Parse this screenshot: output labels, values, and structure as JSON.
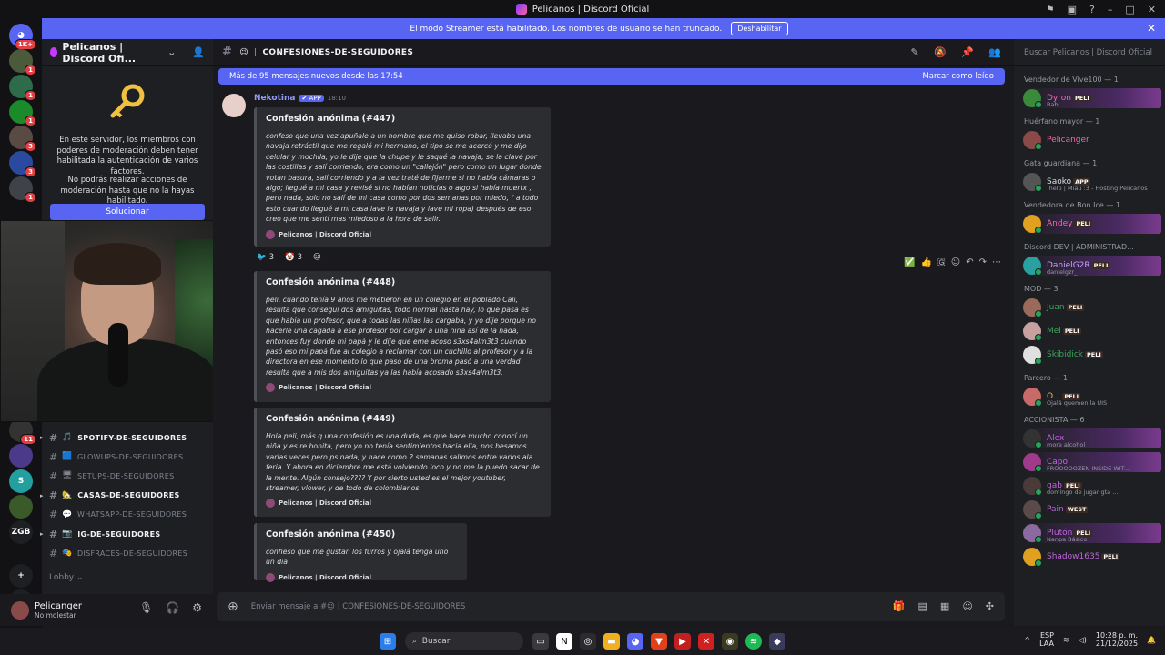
{
  "window": {
    "title": "Pelicanos | Discord Oficial"
  },
  "streamer_banner": {
    "text": "El modo Streamer está habilitado. Los nombres de usuario se han truncado.",
    "button": "Deshabilitar"
  },
  "guilds": {
    "home_badge": "1K+",
    "items": [
      {
        "badge": "1",
        "color": "#4a5a3a"
      },
      {
        "badge": "1",
        "color": "#2e6b4a"
      },
      {
        "badge": "1",
        "color": "#1a8a2a"
      },
      {
        "badge": "3",
        "color": "#5a4a44"
      },
      {
        "badge": "3",
        "color": "#2a4aa0"
      },
      {
        "badge": "1",
        "color": "#404249"
      },
      {
        "badge": "11",
        "color": "#333"
      },
      {
        "badge": "",
        "color": "#4b3a8a"
      },
      {
        "badge": "",
        "color": "#22a0a0",
        "label": "S"
      },
      {
        "badge": "",
        "color": "#3a5a2a"
      },
      {
        "badge": "",
        "color": "#1e1f22",
        "label": "ZGB"
      }
    ]
  },
  "sidebar": {
    "server_name": "Pelicanos | Discord Ofi...",
    "mod_text_1": "En este servidor, los miembros con poderes de moderación deben tener habilitada la autenticación de varios factores.",
    "mod_text_2": "No podrás realizar acciones de moderación hasta que no la hayas habilitado.",
    "fix_button": "Solucionar",
    "channels": [
      {
        "emoji": "🎵",
        "name": "SPOTIFY-DE-SEGUIDORES",
        "bold": true,
        "arrow": true
      },
      {
        "emoji": "🟦",
        "name": "GLOWUPS-DE-SEGUIDORES",
        "bold": false,
        "arrow": false
      },
      {
        "emoji": "🖥",
        "name": "SETUPS-DE-SEGUIDORES",
        "bold": false,
        "arrow": false
      },
      {
        "emoji": "🏡",
        "name": "CASAS-DE-SEGUIDORES",
        "bold": true,
        "arrow": true
      },
      {
        "emoji": "💬",
        "name": "WHATSAPP-DE-SEGUIDORES",
        "bold": false,
        "arrow": false
      },
      {
        "emoji": "📷",
        "name": "IG-DE-SEGUIDORES",
        "bold": true,
        "arrow": true
      },
      {
        "emoji": "🎭",
        "name": "DISFRACES-DE-SEGUIDORES",
        "bold": false,
        "arrow": false
      }
    ],
    "lobby": "Lobby"
  },
  "user": {
    "name": "Pelicanger",
    "status": "No molestar"
  },
  "channel": {
    "name": "CONFESIONES-DE-SEGUIDORES",
    "emoji": "😉"
  },
  "new_messages": {
    "text": "Más de 95 mensajes nuevos desde las 17:54",
    "action": "Marcar como leído"
  },
  "message": {
    "author": "Nekotina",
    "app_tag": "✔ APP",
    "time": "18:10"
  },
  "embeds": [
    {
      "title": "Confesión anónima (#447)",
      "body": "confeso que una vez apuñale a un hombre que me quiso robar, llevaba una navaja retráctil que me regaló mi hermano, el tipo se me acercó y me dijo celular y mochila, yo le dije que la chupe y le saqué la navaja, se la clavé por las costillas y salí corriendo, era como un \"callejón\" pero como un lugar donde votan basura, salí corriendo y a la vez traté de fijarme si no había cámaras o algo; llegué a mi casa y revisé si no habían noticias o algo si había muertx , pero nada, solo no salí de mi casa como por dos semanas por miedo, ( a todo esto cuando llegué a mi casa lave la navaja y lave mi ropa) después de eso creo que me sentí mas miedoso a la hora de salir.",
      "footer": "Pelicanos | Discord Oficial"
    },
    {
      "title": "Confesión anónima (#448)",
      "body": "peli, cuando tenía 9 años me metieron en un colegio en el poblado Cali, resulta que conseguí dos amiguitas, todo normal hasta hay, lo que pasa es que había un profesor, que a todas las niñas las cargaba, y yo dije porque no hacerle una cagada a ese profesor por cargar a una niña así de la nada, entonces fuy donde mi papá y le dije que eme acoso s3xs4alm3t3 cuando pasó eso mi papá fue al colegio a reclamar con un cuchillo al profesor y a la directora en ese momento lo que pasó de una broma pasó a una verdad resulta que a mis dos amiguitas ya las había acosado s3xs4alm3t3.",
      "footer": "Pelicanos | Discord Oficial"
    },
    {
      "title": "Confesión anónima (#449)",
      "body": "Hola peli, más q una confesión es una duda, es que hace mucho conocí un niña y es re bonita, pero yo no tenía sentimientos hacia ella, nos besamos varias veces pero ps nada, y hace como 2 semanas salimos entre varios ala feria. Y ahora en diciembre me está volviendo loco y no me la puedo sacar de la mente. Algún consejo???? Y por cierto usted es el mejor youtuber, streamer, vlower, y de todo de colombianos",
      "footer": "Pelicanos | Discord Oficial"
    },
    {
      "title": "Confesión anónima (#450)",
      "body": "confieso que me gustan los furros y ojalá tenga uno un dia",
      "footer": "Pelicanos | Discord Oficial"
    }
  ],
  "reactions": [
    {
      "emoji": "🐦",
      "count": "3"
    },
    {
      "emoji": "🤡",
      "count": "3"
    }
  ],
  "composer": {
    "placeholder": "Enviar mensaje a #😉 | CONFESIONES-DE-SEGUIDORES"
  },
  "members": {
    "search_placeholder": "Buscar Pelicanos | Discord Oficial",
    "groups": [
      {
        "role": "Vendedor de Vive100 — 1",
        "members": [
          {
            "name": "Dyron",
            "tag": "PELI",
            "sub": "Babi",
            "color": "#f266b3",
            "avatar": "#3a8a3a",
            "nitro": true
          }
        ]
      },
      {
        "role": "Huérfano mayor — 1",
        "members": [
          {
            "name": "Pelicanger",
            "tag": "",
            "sub": "",
            "color": "#f266b3",
            "avatar": "#8b4a4a",
            "nitro": false
          }
        ]
      },
      {
        "role": "Gata guardiana — 1",
        "members": [
          {
            "name": "Saoko",
            "tag": "APP",
            "sub": "!help | Miau :3 - Hosting Pelicanos",
            "color": "#dbdee1",
            "avatar": "#555",
            "nitro": false
          }
        ]
      },
      {
        "role": "Vendedora de Bon Ice — 1",
        "members": [
          {
            "name": "Andey",
            "tag": "PELI",
            "sub": "",
            "color": "#f266b3",
            "avatar": "#e0a020",
            "nitro": true
          }
        ]
      },
      {
        "role": "Discord DEV | ADMINISTRAD...",
        "members": [
          {
            "name": "DanielG2R",
            "tag": "PELI",
            "sub": "danielgzr_",
            "color": "#c9a0ff",
            "avatar": "#2aa0a0",
            "nitro": true
          }
        ]
      },
      {
        "role": "MOD — 3",
        "members": [
          {
            "name": "Juan",
            "tag": "PELI",
            "sub": "",
            "color": "#3ba55d",
            "avatar": "#9a6a5a",
            "nitro": false
          },
          {
            "name": "Mel",
            "tag": "PELI",
            "sub": "",
            "color": "#3ba55d",
            "avatar": "#c8a0a0",
            "nitro": false
          },
          {
            "name": "Skibidick",
            "tag": "PELI",
            "sub": "",
            "color": "#3ba55d",
            "avatar": "#e0e0e0",
            "nitro": false
          }
        ]
      },
      {
        "role": "Parcero — 1",
        "members": [
          {
            "name": "O...",
            "tag": "PELI",
            "sub": "Ojalá quemen la UIS",
            "color": "#f2b84b",
            "avatar": "#c86a6a",
            "nitro": false
          }
        ]
      },
      {
        "role": "ACCIONISTA — 6",
        "members": [
          {
            "name": "Alex",
            "tag": "",
            "sub": "more alcohol",
            "color": "#c064e0",
            "avatar": "#333",
            "nitro": true
          },
          {
            "name": "Capo",
            "tag": "",
            "sub": "FROOOOOZEN INSIDE WIT...",
            "color": "#c064e0",
            "avatar": "#a03a8a",
            "nitro": true
          },
          {
            "name": "gab",
            "tag": "PELI",
            "sub": "domingo de jugar gta ...",
            "color": "#c064e0",
            "avatar": "#4a3a3a",
            "nitro": false
          },
          {
            "name": "Pain",
            "tag": "WEST",
            "sub": "",
            "color": "#c064e0",
            "avatar": "#5a4a4a",
            "nitro": false
          },
          {
            "name": "Plutón",
            "tag": "PELI",
            "sub": "Nanpa Básico",
            "color": "#c064e0",
            "avatar": "#8a6aa0",
            "nitro": true
          },
          {
            "name": "Shadow1635",
            "tag": "PELI",
            "sub": "",
            "color": "#c064e0",
            "avatar": "#e0a020",
            "nitro": false
          }
        ]
      }
    ]
  },
  "taskbar": {
    "search": "Buscar",
    "lang": "ESP",
    "lang2": "LAA",
    "time": "10:28 p. m.",
    "date": "21/12/2025"
  }
}
